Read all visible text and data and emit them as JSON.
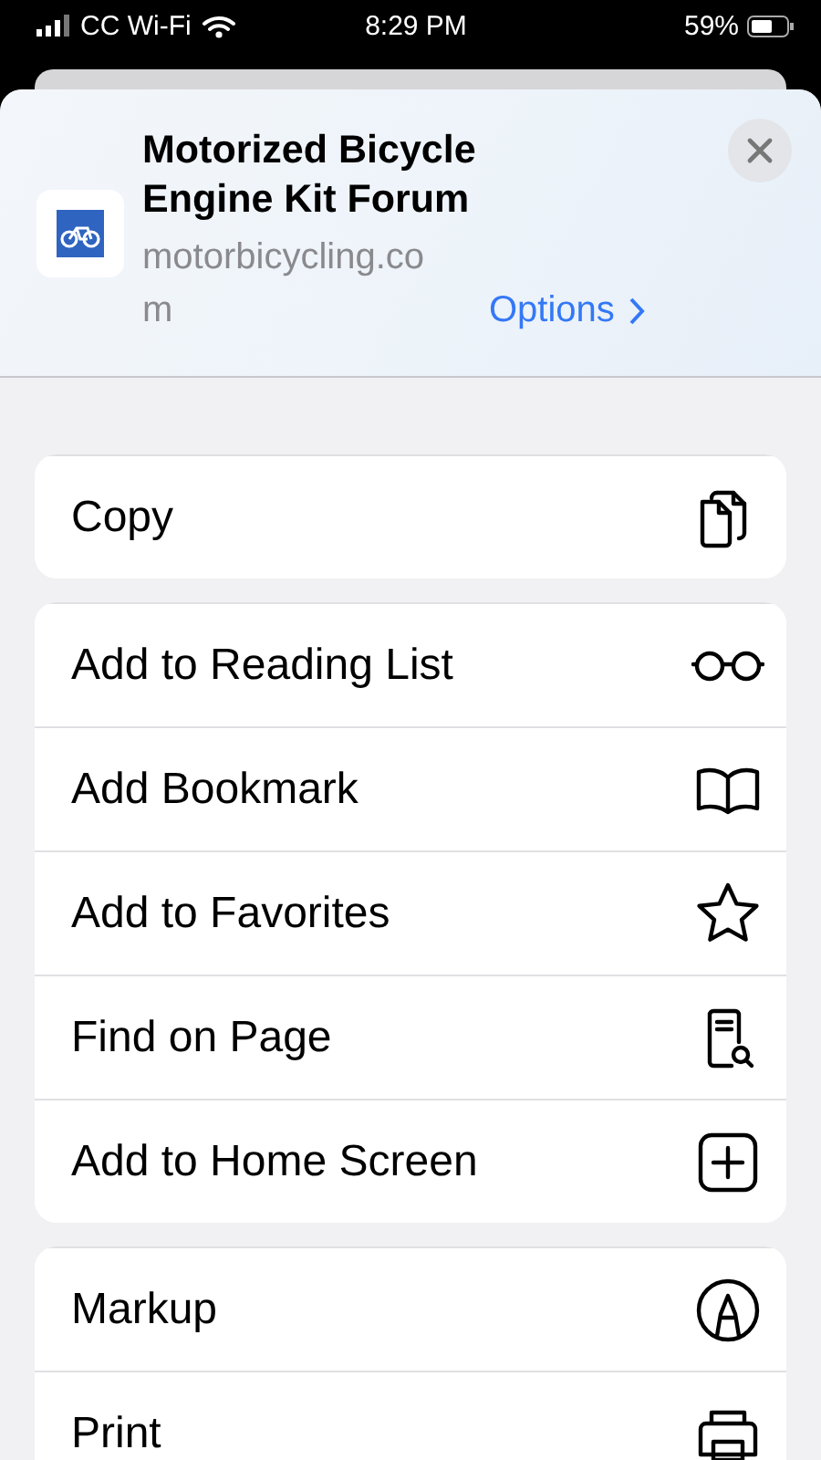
{
  "status_bar": {
    "carrier": "CC Wi-Fi",
    "time": "8:29 PM",
    "battery": "59%"
  },
  "header": {
    "title": "Motorized Bicycle Engine Kit Forum",
    "domain": "motorbicycling.com",
    "options": "Options"
  },
  "groups": [
    {
      "items": [
        {
          "label": "Copy"
        }
      ]
    },
    {
      "items": [
        {
          "label": "Add to Reading List"
        },
        {
          "label": "Add Bookmark"
        },
        {
          "label": "Add to Favorites"
        },
        {
          "label": "Find on Page"
        },
        {
          "label": "Add to Home Screen"
        }
      ]
    },
    {
      "items": [
        {
          "label": "Markup"
        },
        {
          "label": "Print"
        }
      ]
    }
  ]
}
